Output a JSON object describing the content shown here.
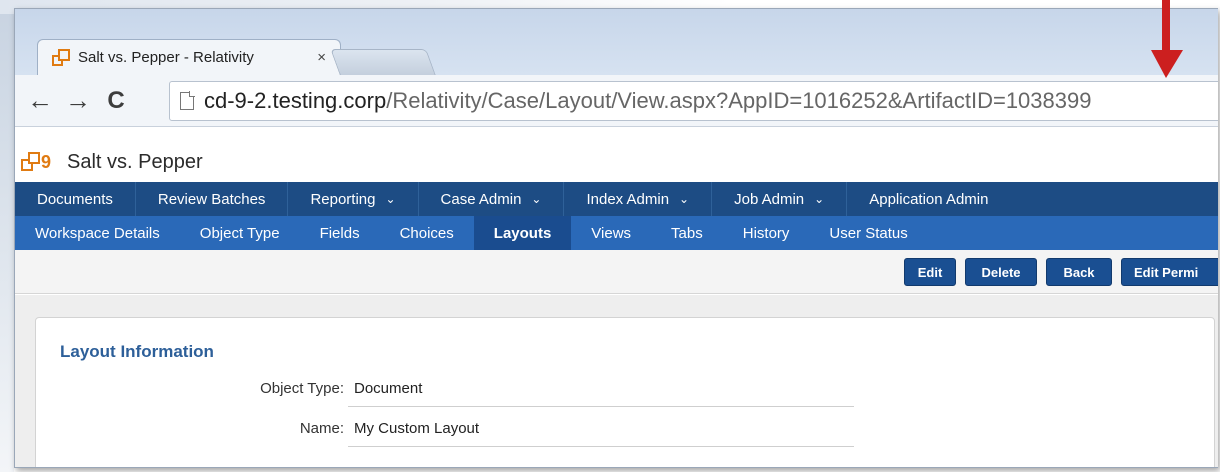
{
  "browser": {
    "tab_title": "Salt vs. Pepper - Relativity",
    "tab_close": "×",
    "url_host": "cd-9-2.testing.corp",
    "url_path": "/Relativity/Case/Layout/View.aspx?AppID=1016252&ArtifactID=1038399",
    "back_icon": "←",
    "forward_icon": "→",
    "reload_icon": "C"
  },
  "app": {
    "title": "Salt vs. Pepper",
    "logo_digit": "9"
  },
  "nav_primary": [
    {
      "label": "Documents",
      "chevron": ""
    },
    {
      "label": "Review Batches",
      "chevron": ""
    },
    {
      "label": "Reporting",
      "chevron": "⌄"
    },
    {
      "label": "Case Admin",
      "chevron": "⌄"
    },
    {
      "label": "Index Admin",
      "chevron": "⌄"
    },
    {
      "label": "Job Admin",
      "chevron": "⌄"
    },
    {
      "label": "Application Admin",
      "chevron": ""
    }
  ],
  "nav_secondary": [
    {
      "label": "Workspace Details"
    },
    {
      "label": "Object Type"
    },
    {
      "label": "Fields"
    },
    {
      "label": "Choices"
    },
    {
      "label": "Layouts"
    },
    {
      "label": "Views"
    },
    {
      "label": "Tabs"
    },
    {
      "label": "History"
    },
    {
      "label": "User Status"
    }
  ],
  "actions": {
    "edit": "Edit",
    "delete": "Delete",
    "back": "Back",
    "edit_permissions": "Edit Permi"
  },
  "layout_info": {
    "heading": "Layout Information",
    "object_type_label": "Object Type:",
    "object_type_value": "Document",
    "name_label": "Name:",
    "name_value": "My Custom Layout"
  },
  "colors": {
    "nav_primary_bg": "#1d4c84",
    "nav_secondary_bg": "#2a69b8",
    "active_tab_bg": "#1a4c8f",
    "accent_orange": "#e07b12",
    "annotation_red": "#cc1f1f"
  }
}
